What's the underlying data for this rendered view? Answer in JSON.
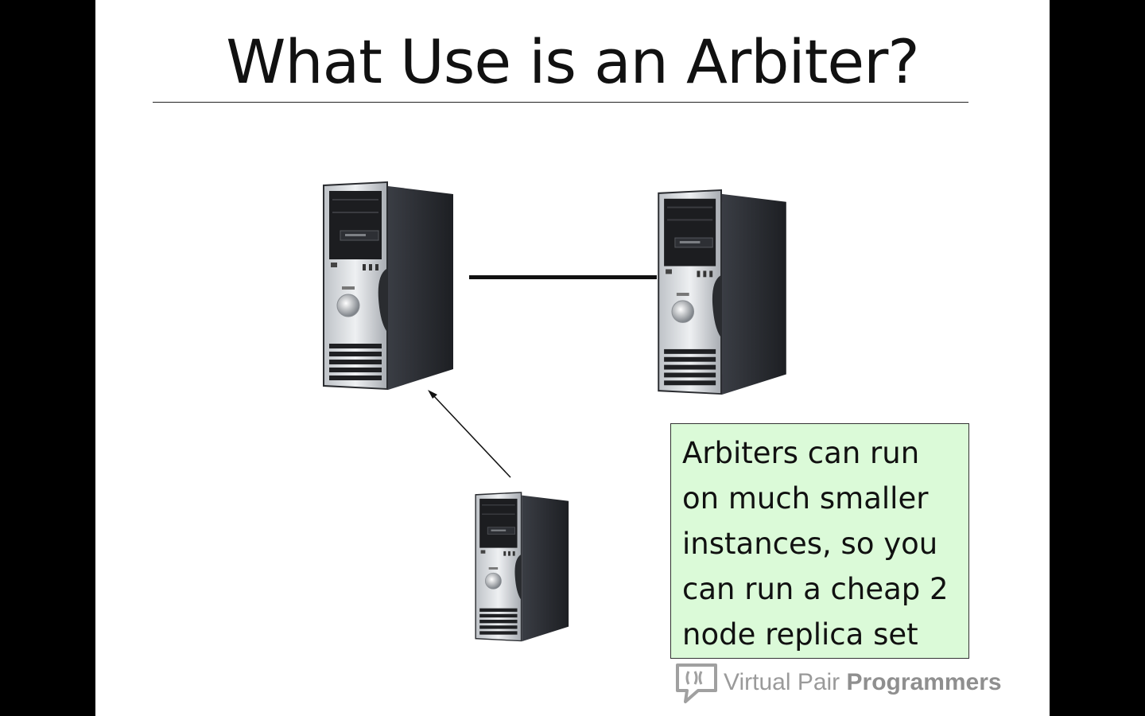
{
  "slide": {
    "title": "What Use is an Arbiter?",
    "callout": {
      "lines": [
        "Arbiters can run",
        "on much smaller",
        "instances, so you",
        "can run a cheap 2",
        "node replica set"
      ]
    },
    "brand": {
      "name_light": "Virtual Pair ",
      "name_bold": "Programmers",
      "icon": "speech-bubble-logo-icon"
    },
    "diagram": {
      "nodes": [
        {
          "role": "server",
          "icon": "tower-server-icon"
        },
        {
          "role": "server",
          "icon": "tower-server-icon"
        },
        {
          "role": "arbiter",
          "icon": "tower-server-icon"
        }
      ]
    },
    "colors": {
      "background": "#000000",
      "slide": "#ffffff",
      "callout_fill": "#dbfad8",
      "text": "#111111",
      "brand_gray": "#9a9a9a"
    }
  }
}
